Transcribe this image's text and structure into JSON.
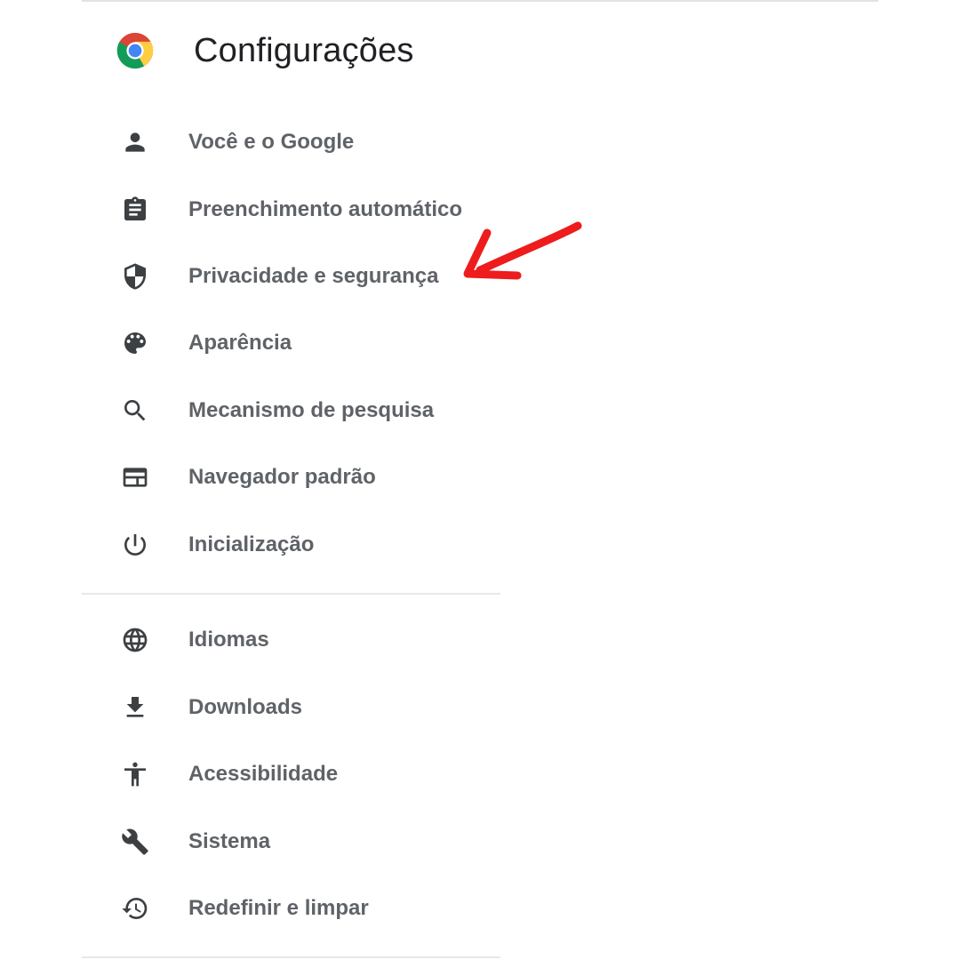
{
  "header": {
    "title": "Configurações",
    "logo_icon": "chrome-logo-icon"
  },
  "menu": {
    "items": [
      {
        "label": "Você e o Google",
        "icon": "person-icon"
      },
      {
        "label": "Preenchimento automático",
        "icon": "clipboard-icon"
      },
      {
        "label": "Privacidade e segurança",
        "icon": "shield-icon"
      },
      {
        "label": "Aparência",
        "icon": "palette-icon"
      },
      {
        "label": "Mecanismo de pesquisa",
        "icon": "search-icon"
      },
      {
        "label": "Navegador padrão",
        "icon": "browser-window-icon"
      },
      {
        "label": "Inicialização",
        "icon": "power-icon"
      },
      {
        "label": "Idiomas",
        "icon": "globe-icon"
      },
      {
        "label": "Downloads",
        "icon": "download-icon"
      },
      {
        "label": "Acessibilidade",
        "icon": "accessibility-icon"
      },
      {
        "label": "Sistema",
        "icon": "wrench-icon"
      },
      {
        "label": "Redefinir e limpar",
        "icon": "restore-icon"
      }
    ]
  },
  "colors": {
    "icon": "#3c4043",
    "label": "#5f6368",
    "title": "#202124",
    "annotation_arrow": "#ee1c1c"
  }
}
